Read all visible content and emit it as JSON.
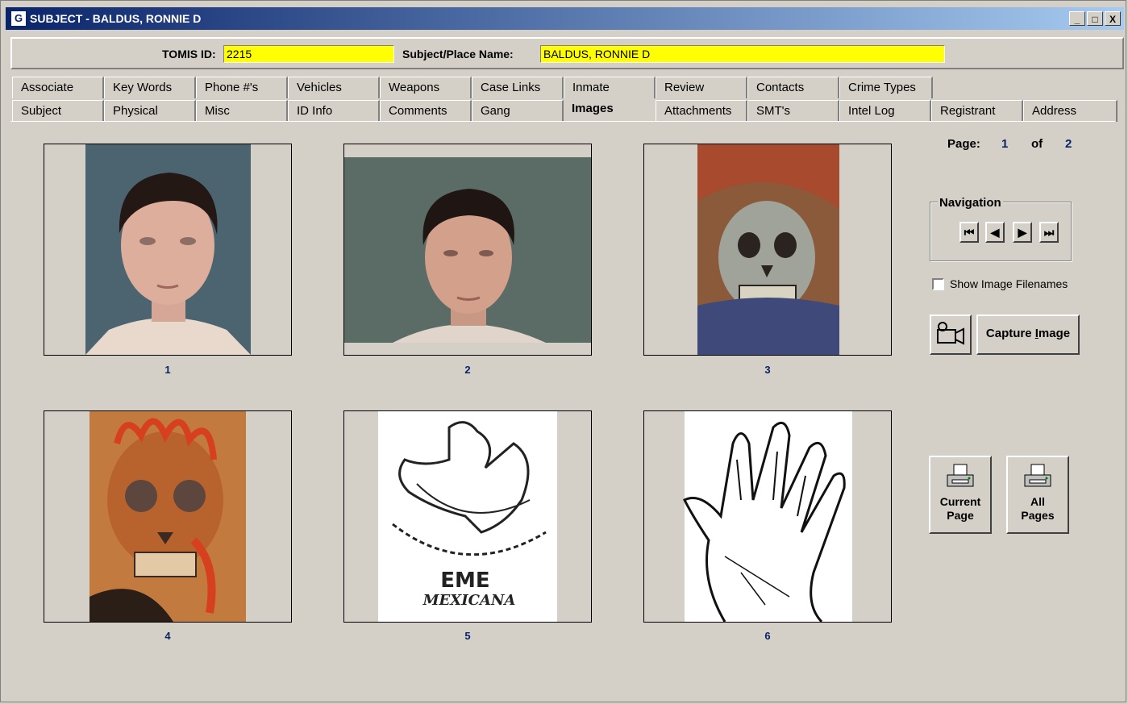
{
  "window": {
    "title": "SUBJECT - BALDUS, RONNIE D",
    "app_icon": "G",
    "min": "_",
    "max": "□",
    "close": "X"
  },
  "ids": {
    "tomis_label": "TOMIS ID:",
    "tomis_value": "2215",
    "name_label": "Subject/Place Name:",
    "name_value": "BALDUS, RONNIE D"
  },
  "tabs_top": [
    "Associate",
    "Key Words",
    "Phone #'s",
    "Vehicles",
    "Weapons",
    "Case Links",
    "Inmate",
    "Review",
    "Contacts",
    "Crime Types"
  ],
  "tabs_bottom": [
    "Subject",
    "Physical",
    "Misc",
    "ID Info",
    "Comments",
    "Gang",
    "Images",
    "Attachments",
    "SMT's",
    "Intel Log",
    "Registrant",
    "Address"
  ],
  "active_tab": "Images",
  "images": [
    {
      "number": "1",
      "kind": "mugshot"
    },
    {
      "number": "2",
      "kind": "mugshot"
    },
    {
      "number": "3",
      "kind": "tattoo-skull-pirate"
    },
    {
      "number": "4",
      "kind": "tattoo-skull-flames"
    },
    {
      "number": "5",
      "kind": "drawing-eagle"
    },
    {
      "number": "6",
      "kind": "drawing-hand"
    }
  ],
  "drawing_text": {
    "eme": "EME",
    "mexicana": "MEXICANA"
  },
  "paging": {
    "page_label": "Page:",
    "current": "1",
    "of_label": "of",
    "total": "2"
  },
  "navigation": {
    "legend": "Navigation",
    "first": "⏮",
    "prev": "◀",
    "next": "▶",
    "last": "⏭"
  },
  "show_filenames": {
    "label": "Show Image Filenames",
    "checked": false
  },
  "capture": {
    "label_pre": "Capture ",
    "label_u": "I",
    "label_post": "mage"
  },
  "print": {
    "current_line1": "Current",
    "current_line2": "Page",
    "all_line1": "All",
    "all_line2": "Pages"
  }
}
